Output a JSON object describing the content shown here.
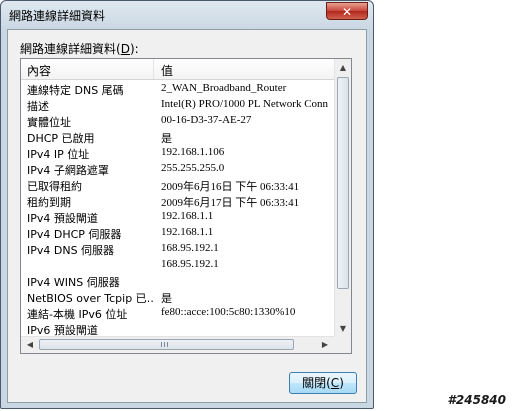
{
  "window": {
    "title": "網路連線詳細資料",
    "close_glyph": "✕"
  },
  "group": {
    "label_main": "網路連線詳細資料(",
    "label_key": "D",
    "label_tail": "):"
  },
  "list": {
    "headers": [
      "內容",
      "值"
    ],
    "rows": [
      {
        "prop": "連線特定 DNS 尾碼",
        "val": "2_WAN_Broadband_Router"
      },
      {
        "prop": "描述",
        "val": "Intel(R) PRO/1000 PL Network Conn"
      },
      {
        "prop": "實體位址",
        "val": "00-16-D3-37-AE-27"
      },
      {
        "prop": "DHCP 已啟用",
        "val": "是"
      },
      {
        "prop": "IPv4 IP 位址",
        "val": "192.168.1.106"
      },
      {
        "prop": "IPv4 子網路遮罩",
        "val": "255.255.255.0"
      },
      {
        "prop": "已取得租約",
        "val": "2009年6月16日 下午 06:33:41"
      },
      {
        "prop": "租約到期",
        "val": "2009年6月17日 下午 06:33:41"
      },
      {
        "prop": "IPv4 預設閘道",
        "val": "192.168.1.1"
      },
      {
        "prop": "IPv4 DHCP 伺服器",
        "val": "192.168.1.1"
      },
      {
        "prop": "IPv4 DNS 伺服器",
        "val": "168.95.192.1"
      },
      {
        "prop": "",
        "val": "168.95.192.1"
      },
      {
        "prop": "IPv4 WINS 伺服器",
        "val": ""
      },
      {
        "prop": "NetBIOS over Tcpip 已…",
        "val": "是"
      },
      {
        "prop": "連結-本機 IPv6 位址",
        "val": "fe80::acce:100:5c80:1330%10"
      },
      {
        "prop": "IPv6 預設閘道",
        "val": ""
      }
    ]
  },
  "buttons": {
    "close_main": "關閉(",
    "close_key": "C",
    "close_tail": ")"
  },
  "watermark": "#245840"
}
